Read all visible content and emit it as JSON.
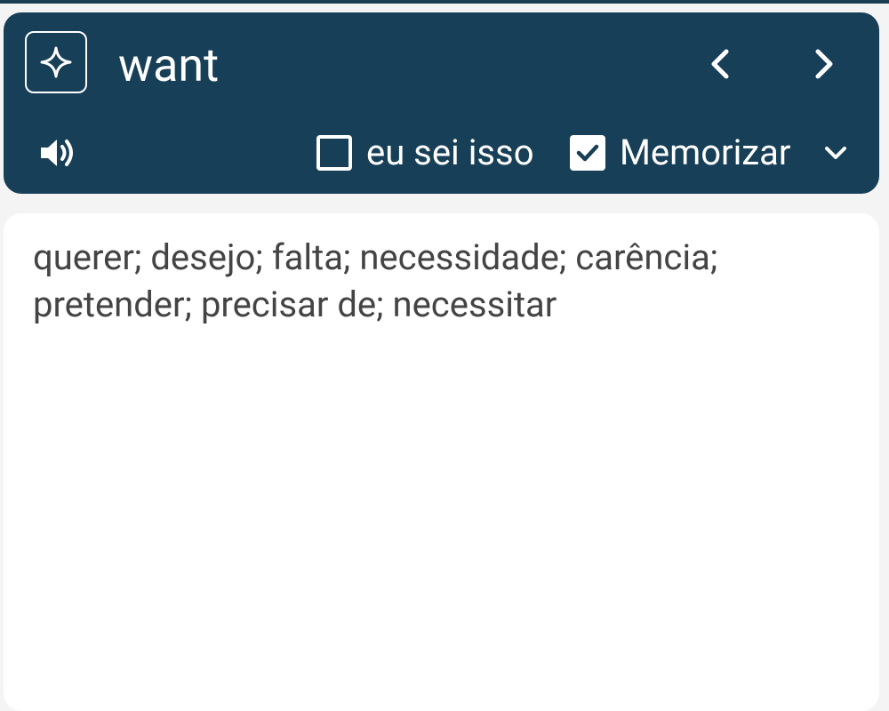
{
  "header": {
    "word": "want",
    "know_label": "eu sei isso",
    "know_checked": false,
    "memorize_label": "Memorizar",
    "memorize_checked": true
  },
  "icons": {
    "ai": "sparkle-icon",
    "prev": "chevron-left-icon",
    "next": "chevron-right-icon",
    "audio": "speaker-icon",
    "dropdown": "chevron-down-icon"
  },
  "content": {
    "definition": "querer; desejo; falta; necessidade; carência; pretender; precisar de; necessitar"
  },
  "colors": {
    "header_bg": "#173f57",
    "page_bg": "#f4f4f4",
    "card_bg": "#ffffff",
    "text": "#444444"
  }
}
